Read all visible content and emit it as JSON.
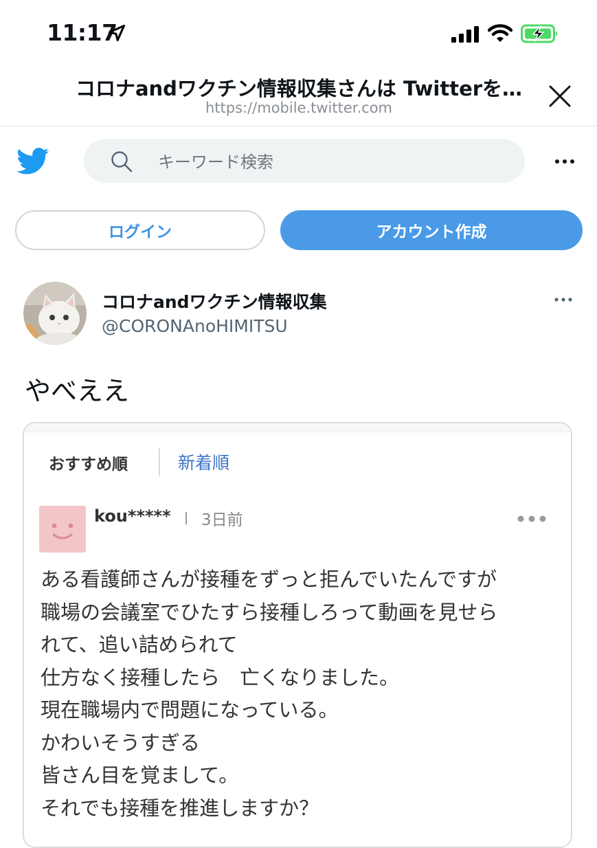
{
  "status_bar": {
    "time": "11:17",
    "icons": [
      "location-arrow-icon",
      "cellular-signal-icon",
      "wifi-icon",
      "battery-charging-icon"
    ]
  },
  "browser_header": {
    "title": "コロナandワクチン情報収集さんは Twitterを…",
    "url": "https://mobile.twitter.com",
    "close_icon": "close-icon"
  },
  "search": {
    "placeholder": "キーワード検索"
  },
  "buttons": {
    "login": "ログイン",
    "signup": "アカウント作成"
  },
  "tweet": {
    "name": "コロナandワクチン情報収集",
    "handle": "@CORONAnoHIMITSU",
    "text": "やべええ"
  },
  "embedded": {
    "tab_recommended": "おすすめ順",
    "tab_newest": "新着順",
    "comment": {
      "user": "kou*****",
      "date": "3日前",
      "lines": [
        "ある看護師さんが接種をずっと拒んでいたんですが",
        "職場の会議室でひたすら接種しろって動画を見せら",
        "れて、追い詰められて",
        "仕方なく接種したら　亡くなりました。",
        "現在職場内で問題になっている。",
        "かわいそうすぎる",
        "皆さん目を覚まして。",
        "それでも接種を推進しますか？"
      ]
    }
  },
  "colors": {
    "twitter_blue": "#1d9bf0",
    "signup_button": "#4a9ae8",
    "login_text": "#3f93e8",
    "battery_green": "#4cd964",
    "tab_link": "#3c74c8",
    "comment_avatar": "#f2c5c7"
  }
}
